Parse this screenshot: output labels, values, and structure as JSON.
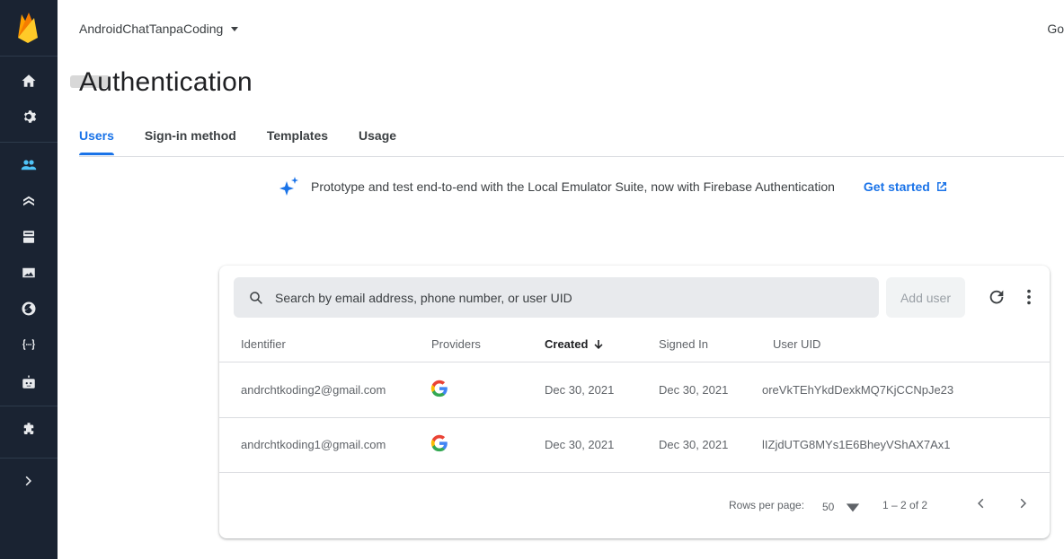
{
  "app": {
    "project_name": "AndroidChatTanpaCoding",
    "top_right_text": "Go",
    "page_title": "Authentication"
  },
  "tabs": [
    {
      "label": "Users",
      "active": true
    },
    {
      "label": "Sign-in method",
      "active": false
    },
    {
      "label": "Templates",
      "active": false
    },
    {
      "label": "Usage",
      "active": false
    }
  ],
  "banner": {
    "icon": "sparkle-icon",
    "text": "Prototype and test end-to-end with the Local Emulator Suite, now with Firebase Authentication",
    "link_label": "Get started"
  },
  "sidebar": {
    "icons": [
      "firebase-logo",
      "home-icon",
      "settings-icon",
      "users-icon",
      "firestore-icon",
      "database-icon",
      "storage-icon",
      "hosting-icon",
      "functions-icon",
      "ml-icon",
      "extensions-icon",
      "expand-icon"
    ]
  },
  "users_table": {
    "search_placeholder": "Search by email address, phone number, or user UID",
    "add_user_label": "Add user",
    "columns": {
      "identifier": "Identifier",
      "providers": "Providers",
      "created": "Created",
      "signed_in": "Signed In",
      "user_uid": "User UID"
    },
    "rows": [
      {
        "identifier": "andrchtkoding2@gmail.com",
        "provider": "google-icon",
        "created": "Dec 30, 2021",
        "signed_in": "Dec 30, 2021",
        "uid": "oreVkTEhYkdDexkMQ7KjCCNpJe23"
      },
      {
        "identifier": "andrchtkoding1@gmail.com",
        "provider": "google-icon",
        "created": "Dec 30, 2021",
        "signed_in": "Dec 30, 2021",
        "uid": "lIZjdUTG8MYs1E6BheyVShAX7Ax1"
      }
    ],
    "pagination": {
      "rows_per_page_label": "Rows per page:",
      "rows_per_page_value": "50",
      "range": "1 – 2 of 2"
    }
  },
  "colors": {
    "sidebar_bg": "#1a2332",
    "accent": "#1a73e8",
    "firebase_orange": "#ffa000"
  }
}
